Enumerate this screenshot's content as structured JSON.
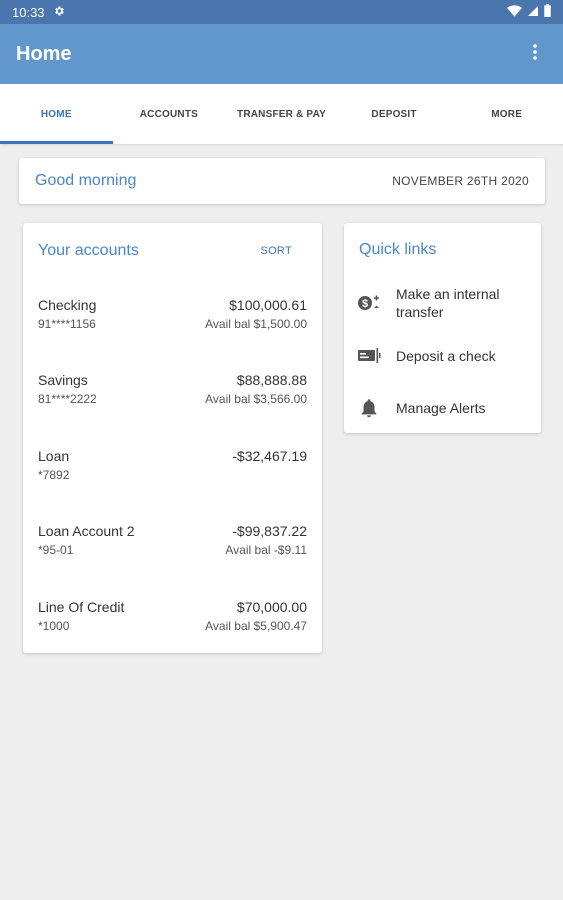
{
  "status": {
    "time": "10:33"
  },
  "app_bar": {
    "title": "Home"
  },
  "tabs": [
    {
      "label": "HOME",
      "active": true
    },
    {
      "label": "ACCOUNTS",
      "active": false
    },
    {
      "label": "TRANSFER & PAY",
      "active": false
    },
    {
      "label": "DEPOSIT",
      "active": false
    },
    {
      "label": "MORE",
      "active": false
    }
  ],
  "greeting": {
    "text": "Good morning",
    "date": "NOVEMBER 26TH 2020"
  },
  "accounts": {
    "title": "Your accounts",
    "sort_label": "SORT",
    "items": [
      {
        "name": "Checking",
        "number": "91****1156",
        "balance": "$100,000.61",
        "avail": "Avail bal $1,500.00"
      },
      {
        "name": "Savings",
        "number": "81****2222",
        "balance": "$88,888.88",
        "avail": "Avail bal $3,566.00"
      },
      {
        "name": "Loan",
        "number": "*7892",
        "balance": "-$32,467.19",
        "avail": ""
      },
      {
        "name": "Loan Account 2",
        "number": "*95-01",
        "balance": "-$99,837.22",
        "avail": "Avail bal -$9.11"
      },
      {
        "name": "Line Of Credit",
        "number": "*1000",
        "balance": "$70,000.00",
        "avail": "Avail bal $5,900.47"
      }
    ]
  },
  "quick_links": {
    "title": "Quick links",
    "items": [
      {
        "label": "Make an internal transfer",
        "icon": "transfer-icon"
      },
      {
        "label": "Deposit a check",
        "icon": "check-deposit-icon"
      },
      {
        "label": "Manage Alerts",
        "icon": "bell-icon"
      }
    ]
  },
  "colors": {
    "status_bar": "#4a76ad",
    "app_bar": "#6297cc",
    "accent": "#3a73b8",
    "heading": "#4a86c8",
    "background": "#eeeeee"
  }
}
